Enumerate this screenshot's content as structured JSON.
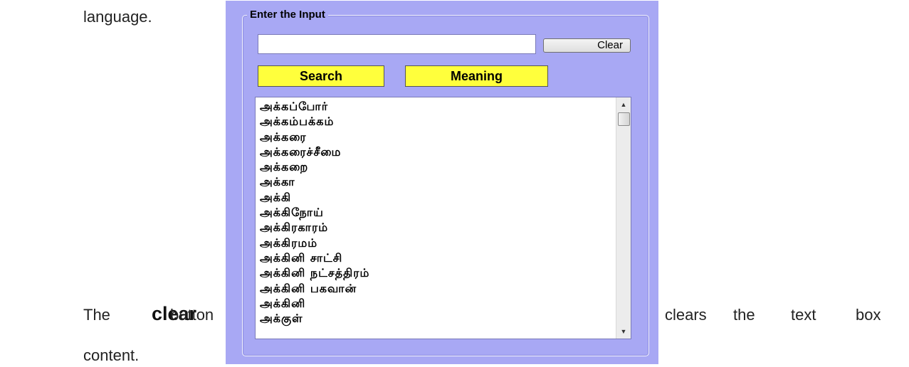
{
  "document": {
    "top_text": "language.",
    "line_prefix": "The",
    "line_bold": "clear",
    "line_middle": "button",
    "line_suffix_words": [
      "clears",
      "the",
      "text",
      "box"
    ],
    "bottom_text": "content."
  },
  "app": {
    "background_color": "#a8a8f4",
    "group_title": "Enter the Input",
    "input_value": "",
    "clear_label": "Clear",
    "search_label": "Search",
    "meaning_label": "Meaning",
    "button_color": "#ffff3c",
    "words": [
      "அக்கப்போர்",
      "அக்கம்பக்கம்",
      "அக்கரை",
      "அக்கரைச்சீமை",
      "அக்கறை",
      "அக்கா",
      "அக்கி",
      "அக்கிநோய்",
      "அக்கிரகாரம்",
      "அக்கிரமம்",
      "அக்கினி சாட்சி",
      "அக்கினி நட்சத்திரம்",
      "அக்கினி பகவான்",
      "அக்கினி",
      "அக்குள்"
    ],
    "scroll_up_icon": "scroll-up-arrow",
    "scroll_down_icon": "scroll-down-arrow"
  }
}
